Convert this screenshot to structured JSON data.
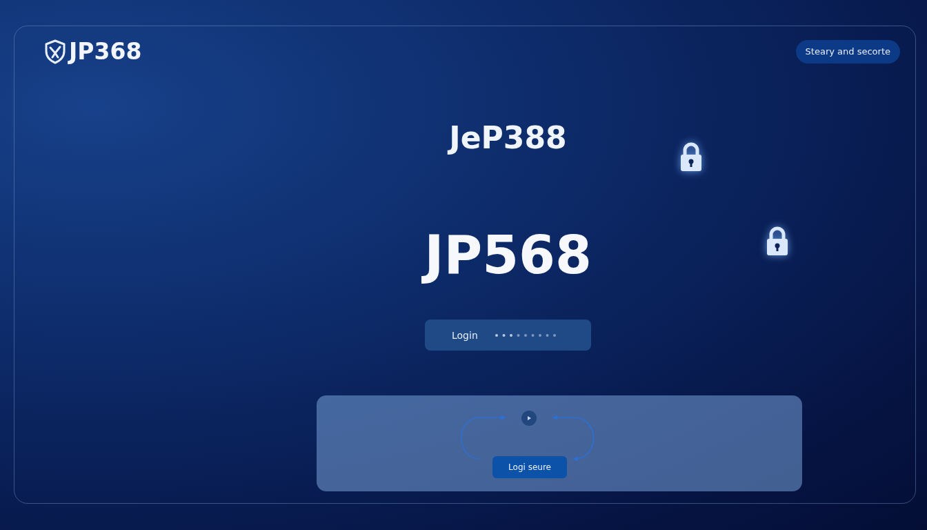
{
  "brand": {
    "name": "JP368"
  },
  "badge": "Steary and secorte",
  "heading": "JeP388",
  "title": "JP568",
  "login_field": {
    "label": "Login"
  },
  "panel": {
    "button": "Logi seure"
  }
}
